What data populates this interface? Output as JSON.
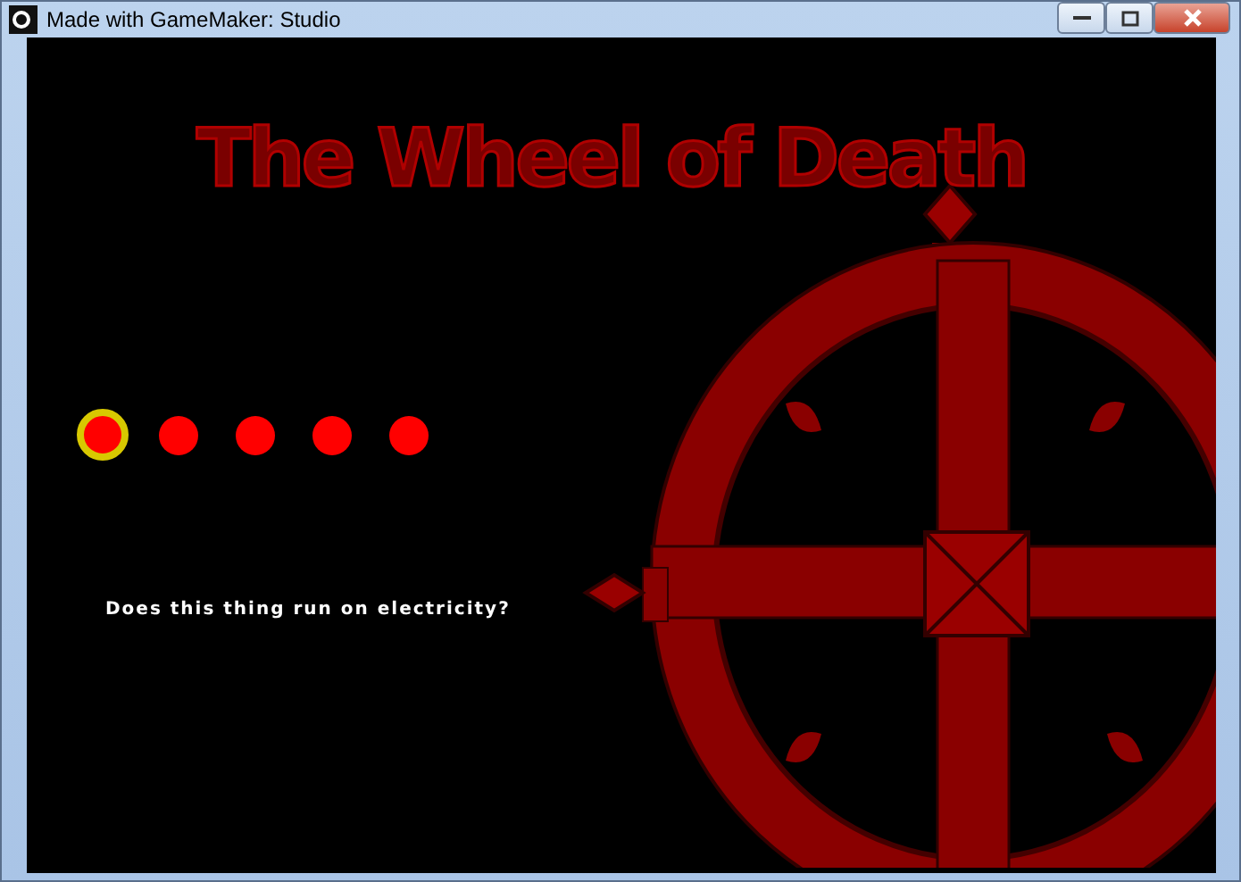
{
  "window": {
    "title": "Made with GameMaker: Studio"
  },
  "game": {
    "title": "The Wheel of Death",
    "questions": [
      {
        "selected": true
      },
      {
        "selected": false
      },
      {
        "selected": false
      },
      {
        "selected": false
      },
      {
        "selected": false
      }
    ],
    "question": "Does this thing run on electricity?"
  }
}
